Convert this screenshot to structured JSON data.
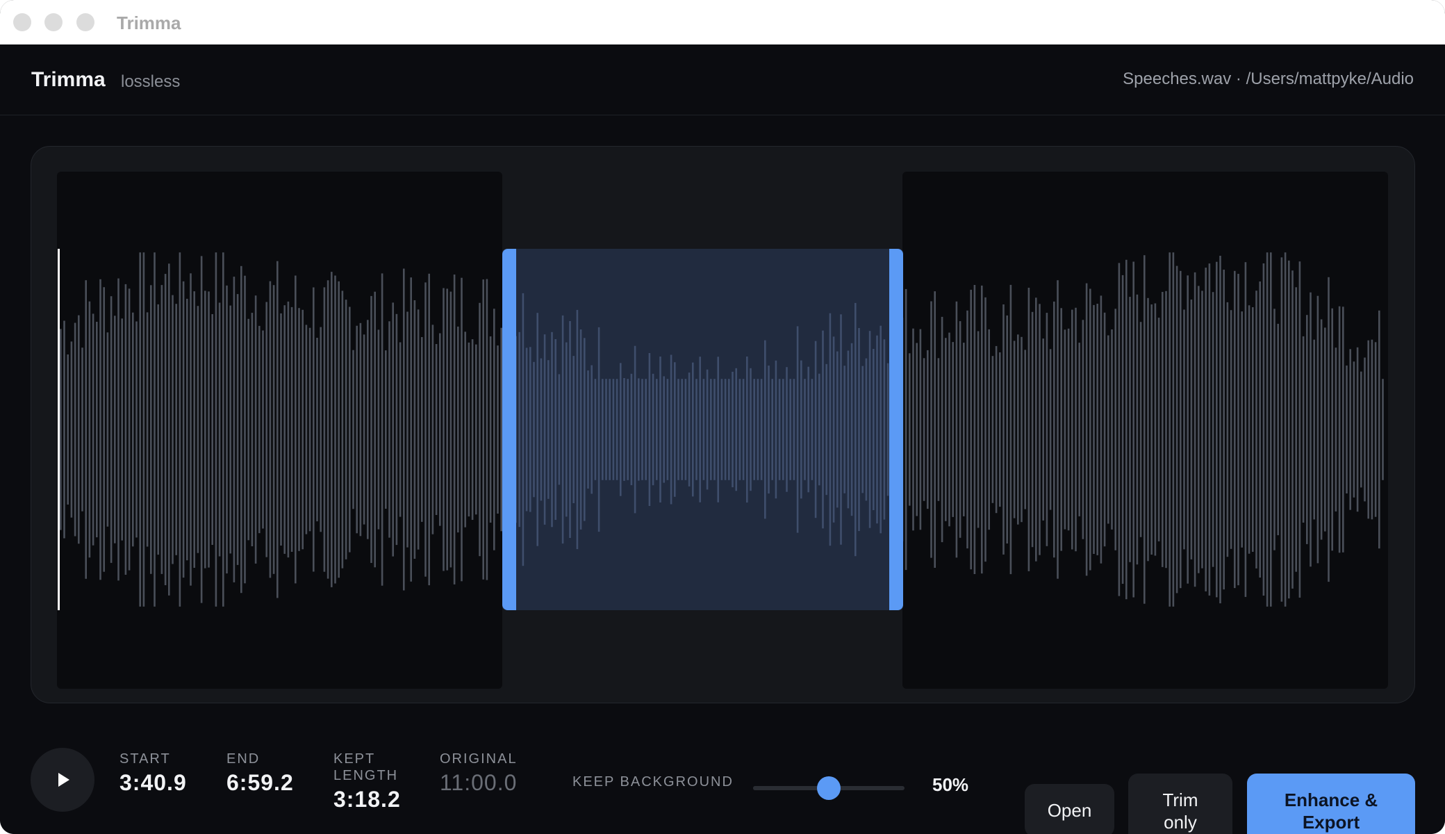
{
  "window": {
    "title": "Trimma"
  },
  "header": {
    "app_name": "Trimma",
    "badge": "lossless",
    "file_path": "Speeches.wav · /Users/mattpyke/Audio"
  },
  "timing": {
    "start": {
      "label": "START",
      "value": "3:40.9"
    },
    "end": {
      "label": "END",
      "value": "6:59.2"
    },
    "kept": {
      "label": "KEPT LENGTH",
      "value": "3:18.2"
    },
    "original": {
      "label": "ORIGINAL",
      "value": "11:00.0"
    }
  },
  "selection": {
    "start_seconds": 220.9,
    "end_seconds": 419.2,
    "total_seconds": 660.0,
    "playhead_seconds": 0
  },
  "background": {
    "label": "KEEP BACKGROUND",
    "value_display": "50%",
    "level": 0.5
  },
  "buttons": {
    "open": "Open",
    "trim_only": "Trim only",
    "enhance_export": "Enhance & Export"
  },
  "colors": {
    "accent": "#5b9af5",
    "waveform": "#4a4f59",
    "waveform_selected": "#3f4e6c",
    "background": "#0b0c10",
    "panel": "#15171b"
  },
  "icons": {
    "play": "play-icon"
  }
}
